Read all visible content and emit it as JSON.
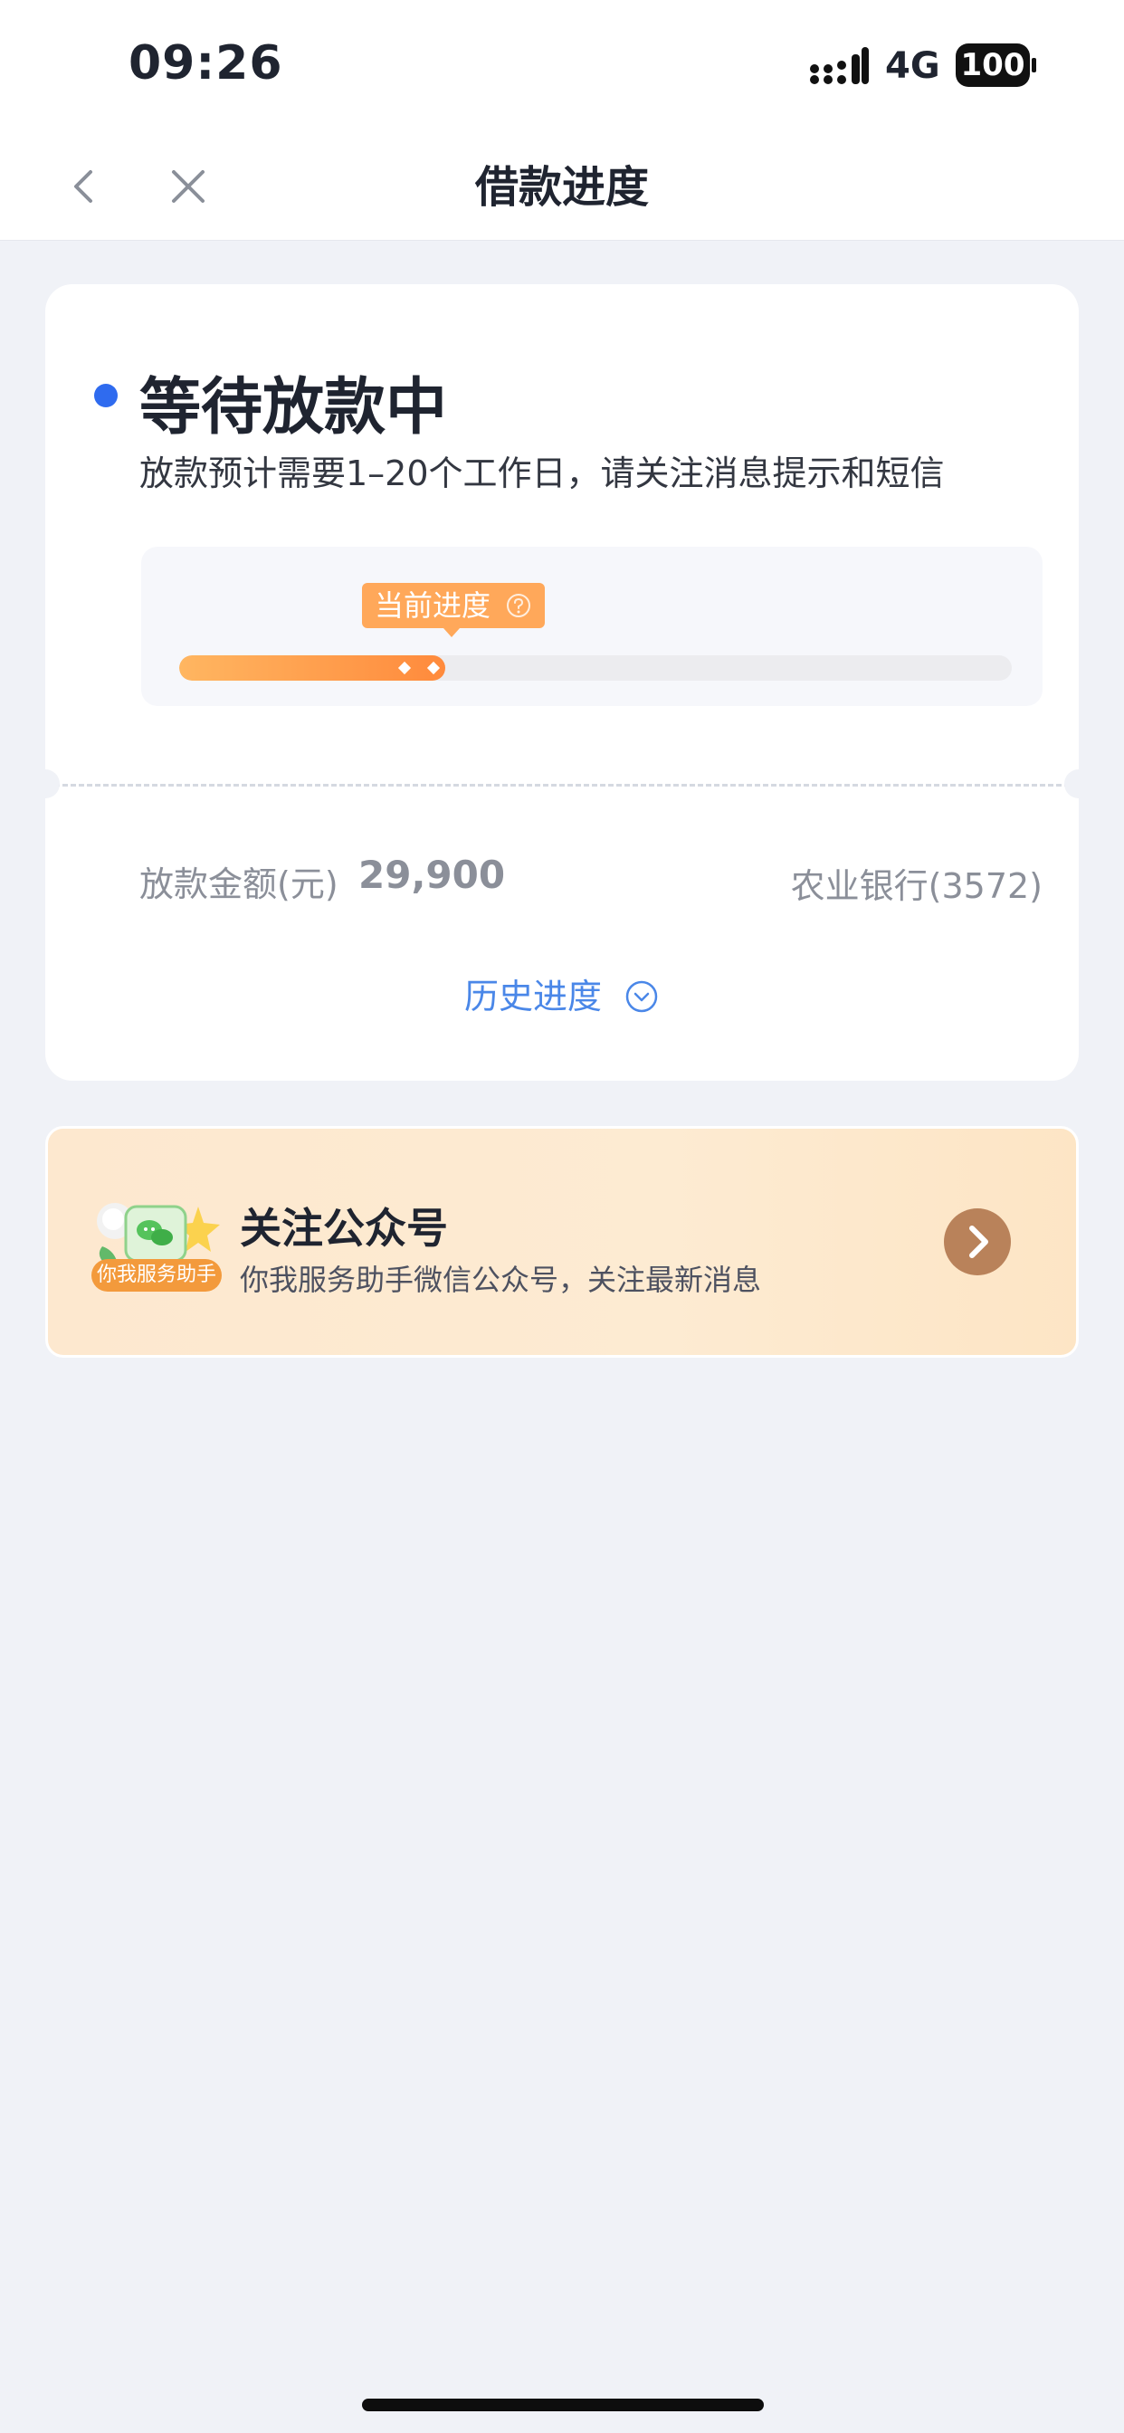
{
  "status_bar": {
    "time": "09:26",
    "network": "4G",
    "battery": "100"
  },
  "nav": {
    "title": "借款进度"
  },
  "status_card": {
    "title": "等待放款中",
    "description": "放款预计需要1–20个工作日，请关注消息提示和短信",
    "progress_tag": "当前进度",
    "progress_fraction": 0.32,
    "amount_label": "放款金额(元)",
    "amount_value": "29,900",
    "bank": "农业银行(3572)",
    "history_link": "历史进度"
  },
  "follow_card": {
    "title": "关注公众号",
    "description": "你我服务助手微信公众号，关注最新消息",
    "badge": "你我服务助手"
  },
  "colors": {
    "accent_blue": "#2f6bef",
    "link_blue": "#4a87e8",
    "progress_orange": "#ff8a3c",
    "arrow_brown": "#b9825a"
  }
}
